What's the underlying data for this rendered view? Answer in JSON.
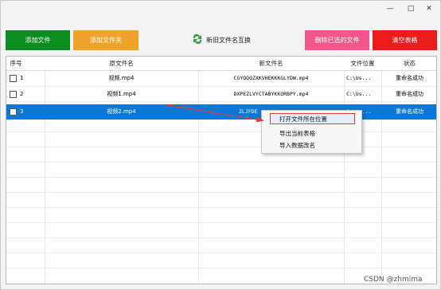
{
  "toolbar": {
    "add_file": "添加文件",
    "add_folder": "添加文件夹",
    "swap": "新旧文件名互换",
    "delete_selected": "删除已选的文件",
    "clear_table": "清空表格"
  },
  "table": {
    "headers": [
      "序号",
      "原文件名",
      "新文件名",
      "文件位置",
      "状态"
    ],
    "rows": [
      {
        "num": "1",
        "orig": "视频.mp4",
        "new": "CGYQQQZXKVHEKKKGLYDW.mp4",
        "loc": "C:\\Us...",
        "status": "重命名成功"
      },
      {
        "num": "2",
        "orig": "视频1.mp4",
        "new": "DXPEZLVYCTABYKKORBPY.mp4",
        "loc": "C:\\Us...",
        "status": "重命名成功"
      },
      {
        "num": "3",
        "orig": "视频2.mp4",
        "new": "ZLJFDE",
        "loc": "C:\\Us...",
        "status": "重命名成功"
      }
    ]
  },
  "context_menu": {
    "items": [
      "打开文件所在位置",
      "导出当前表格",
      "导入数据改名"
    ]
  },
  "watermark": "CSDN @zhmima",
  "colors": {
    "add_file": "#0b8c1f",
    "add_folder": "#f0a22a",
    "delete": "#f2568c",
    "clear": "#ec1b1b",
    "selection": "#0a78d7",
    "annotation": "#e23b3b"
  }
}
